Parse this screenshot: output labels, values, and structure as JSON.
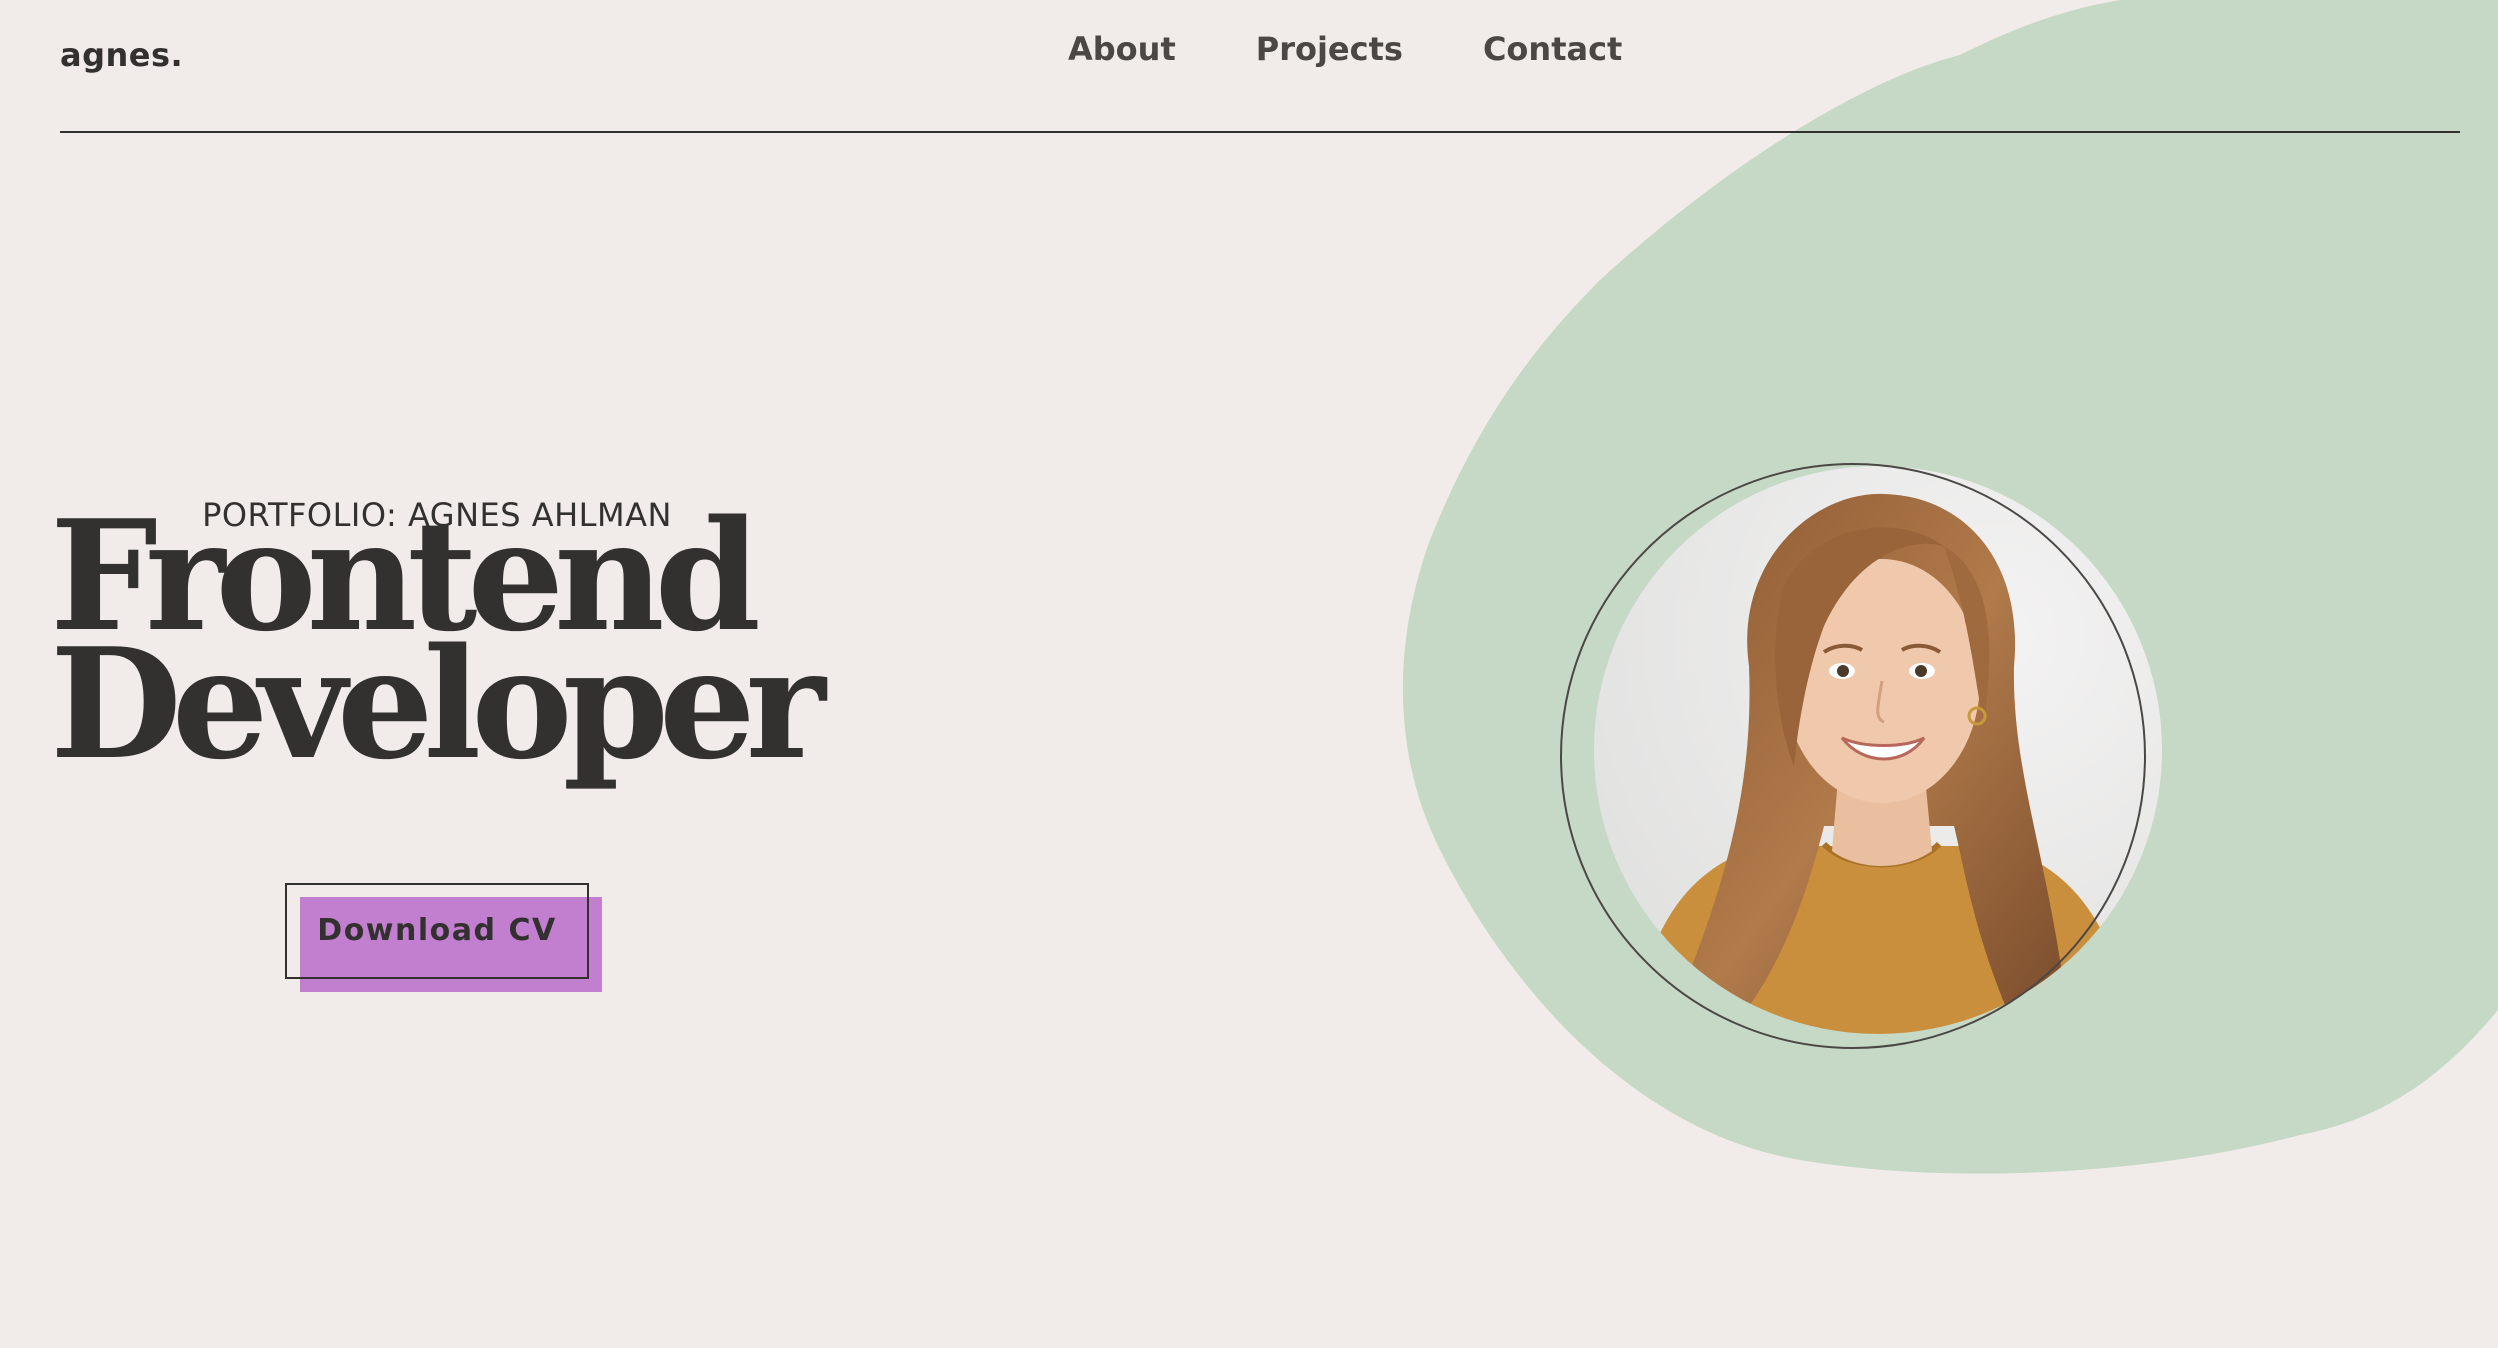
{
  "header": {
    "logo": "agnes.",
    "nav": [
      {
        "label": "About"
      },
      {
        "label": "Projects"
      },
      {
        "label": "Contact"
      }
    ]
  },
  "hero": {
    "eyebrow": "PORTFOLIO: AGNES AHLMAN",
    "headline_line1": "Frontend",
    "headline_line2": "Developer",
    "cta_label": "Download CV"
  },
  "colors": {
    "background": "#f1ecea",
    "blob": "#c6d9c6",
    "text": "#333130",
    "cta_accent": "#c27ecf"
  },
  "icons": {
    "portrait": "portrait-photo"
  }
}
